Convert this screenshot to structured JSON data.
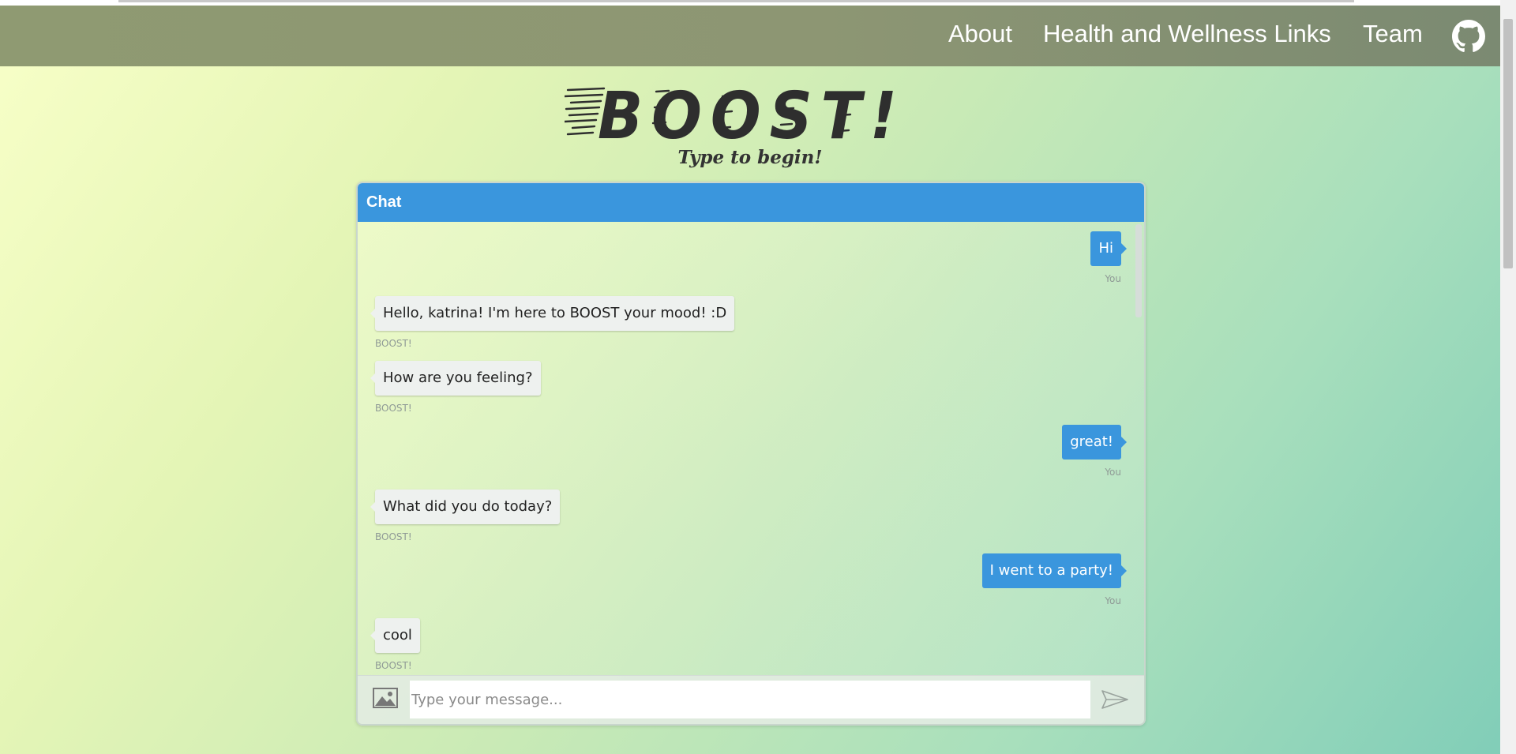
{
  "nav": {
    "links": [
      {
        "label": "About"
      },
      {
        "label": "Health and Wellness Links"
      },
      {
        "label": "Team"
      }
    ]
  },
  "hero": {
    "logo_text": "BOOST!",
    "tagline": "Type to begin!"
  },
  "chat": {
    "title": "Chat",
    "messages": [
      {
        "from": "user",
        "text": "Hi",
        "sender": "You"
      },
      {
        "from": "bot",
        "text": "Hello, katrina! I'm here to BOOST your mood! :D",
        "sender": "BOOST!"
      },
      {
        "from": "bot",
        "text": "How are you feeling?",
        "sender": "BOOST!"
      },
      {
        "from": "user",
        "text": "great!",
        "sender": "You"
      },
      {
        "from": "bot",
        "text": "What did you do today?",
        "sender": "BOOST!"
      },
      {
        "from": "user",
        "text": "I went to a party!",
        "sender": "You"
      },
      {
        "from": "bot",
        "text": "cool",
        "sender": "BOOST!"
      }
    ],
    "input": {
      "placeholder": "Type your message...",
      "value": ""
    }
  },
  "colors": {
    "accent": "#3a96dd",
    "navbar": "#8d9673"
  },
  "icons": {
    "github": "github-icon",
    "image_upload": "image-icon",
    "send": "send-icon"
  }
}
